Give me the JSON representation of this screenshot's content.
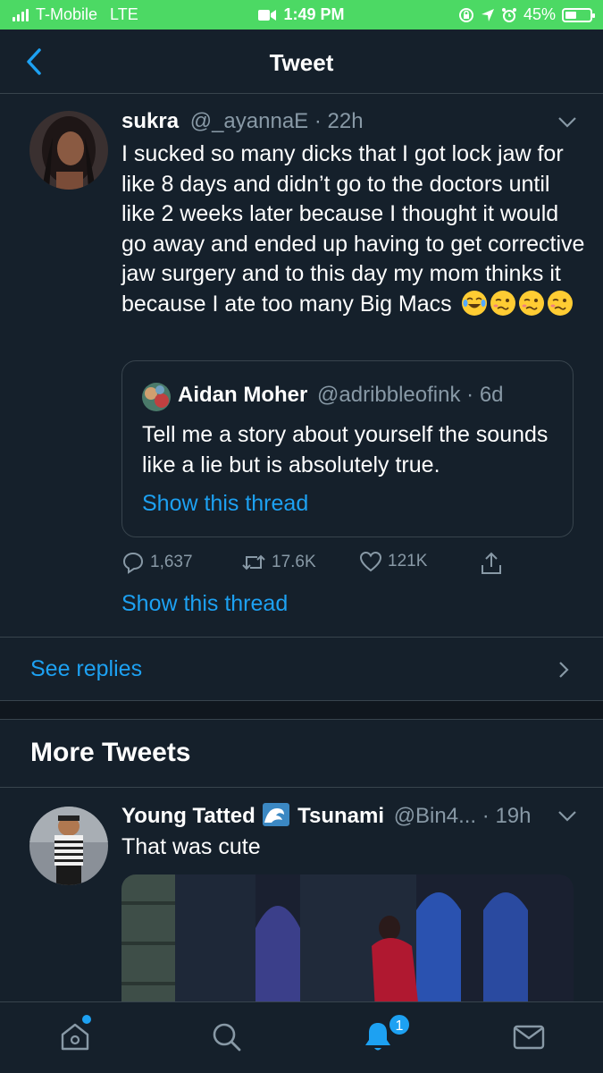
{
  "status_bar": {
    "carrier": "T-Mobile",
    "network": "LTE",
    "time": "1:49 PM",
    "battery": "45%",
    "battery_level": 0.45
  },
  "header": {
    "title": "Tweet"
  },
  "tweet": {
    "name": "sukra",
    "handle": "@_ayannaE",
    "separator": "·",
    "time": "22h",
    "text": "I sucked so many dicks that I got lock jaw for like 8 days and didn’t go to the doctors until like 2 weeks later because I thought it would go away and ended up having to get corrective jaw surgery and to this day my mom thinks it because I ate too many Big Macs",
    "emojis": [
      "joy-emoji",
      "woozy-emoji",
      "woozy-emoji",
      "woozy-emoji"
    ],
    "quote": {
      "name": "Aidan Moher",
      "handle": "@adribbleofink",
      "separator": "·",
      "time": "6d",
      "text": "Tell me a story about yourself the sounds like a lie but is absolutely true.",
      "thread_link": "Show this thread"
    },
    "replies": "1,637",
    "retweets": "17.6K",
    "likes": "121K",
    "thread_link": "Show this thread"
  },
  "see_replies": "See replies",
  "more_tweets_title": "More Tweets",
  "tweet2": {
    "name": "Young Tatted",
    "name_emoji": "wave-emoji",
    "name_suffix": "Tsunami",
    "handle": "@Bin4...",
    "separator": "·",
    "time": "19h",
    "text": "That was cute"
  },
  "tab_bar": {
    "items": [
      "home-icon",
      "search-icon",
      "notifications-icon",
      "messages-icon"
    ],
    "notification_count": "1"
  },
  "colors": {
    "background": "#15202b",
    "accent": "#1da1f2",
    "secondary_text": "#8899a6",
    "border": "#38444d",
    "status_bar": "#4cd964"
  }
}
